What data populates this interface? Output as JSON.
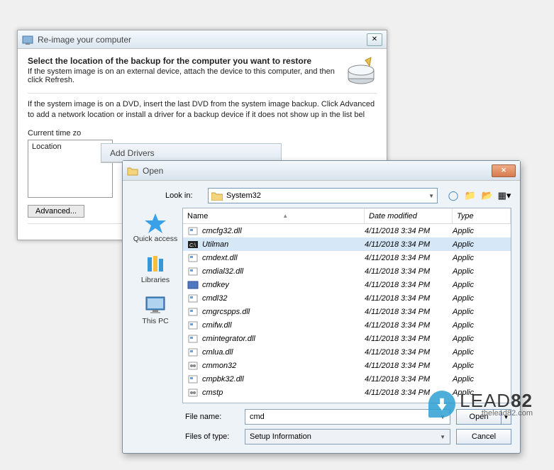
{
  "reimage": {
    "title": "Re-image your computer",
    "headline": "Select the location of the backup for the computer you want to restore",
    "subhead": "If the system image is on an external device, attach the device to this computer, and then click Refresh.",
    "instruction": "If the system image is on a DVD, insert the last DVD from the system image backup. Click Advanced to add a network location or install a driver for a backup device if it does not show up in the list bel",
    "tz_label": "Current time zo",
    "location_header": "Location",
    "advanced_btn": "Advanced..."
  },
  "drivers": {
    "title": "Add Drivers"
  },
  "open": {
    "title": "Open",
    "lookin_label": "Look in:",
    "lookin_value": "System32",
    "nav_icons": [
      "back-icon",
      "up-icon",
      "new-folder-icon",
      "views-icon"
    ],
    "places": [
      {
        "name": "quick-access",
        "label": "Quick access"
      },
      {
        "name": "libraries",
        "label": "Libraries"
      },
      {
        "name": "this-pc",
        "label": "This PC"
      }
    ],
    "columns": {
      "name": "Name",
      "date": "Date modified",
      "type": "Type"
    },
    "files": [
      {
        "icon": "dll",
        "name": "cmcfg32.dll",
        "date": "4/11/2018 3:34 PM",
        "type": "Applic",
        "sel": false
      },
      {
        "icon": "exe",
        "name": "Utilman",
        "date": "4/11/2018 3:34 PM",
        "type": "Applic",
        "sel": true
      },
      {
        "icon": "dll",
        "name": "cmdext.dll",
        "date": "4/11/2018 3:34 PM",
        "type": "Applic",
        "sel": false
      },
      {
        "icon": "dll",
        "name": "cmdial32.dll",
        "date": "4/11/2018 3:34 PM",
        "type": "Applic",
        "sel": false
      },
      {
        "icon": "exe2",
        "name": "cmdkey",
        "date": "4/11/2018 3:34 PM",
        "type": "Applic",
        "sel": false
      },
      {
        "icon": "dll",
        "name": "cmdl32",
        "date": "4/11/2018 3:34 PM",
        "type": "Applic",
        "sel": false
      },
      {
        "icon": "dll",
        "name": "cmgrcspps.dll",
        "date": "4/11/2018 3:34 PM",
        "type": "Applic",
        "sel": false
      },
      {
        "icon": "dll",
        "name": "cmifw.dll",
        "date": "4/11/2018 3:34 PM",
        "type": "Applic",
        "sel": false
      },
      {
        "icon": "dll",
        "name": "cmintegrator.dll",
        "date": "4/11/2018 3:34 PM",
        "type": "Applic",
        "sel": false
      },
      {
        "icon": "dll",
        "name": "cmlua.dll",
        "date": "4/11/2018 3:34 PM",
        "type": "Applic",
        "sel": false
      },
      {
        "icon": "cfg",
        "name": "cmmon32",
        "date": "4/11/2018 3:34 PM",
        "type": "Applic",
        "sel": false
      },
      {
        "icon": "dll",
        "name": "cmpbk32.dll",
        "date": "4/11/2018 3:34 PM",
        "type": "Applic",
        "sel": false
      },
      {
        "icon": "cfg",
        "name": "cmstp",
        "date": "4/11/2018 3:34 PM",
        "type": "Applic",
        "sel": false
      }
    ],
    "filename_label": "File name:",
    "filename_value": "cmd",
    "filetype_label": "Files of type:",
    "filetype_value": "Setup Information",
    "open_btn": "Open",
    "cancel_btn": "Cancel"
  },
  "watermark": {
    "brand": "LEAD",
    "num": "82",
    "url": "thelead82.com"
  }
}
